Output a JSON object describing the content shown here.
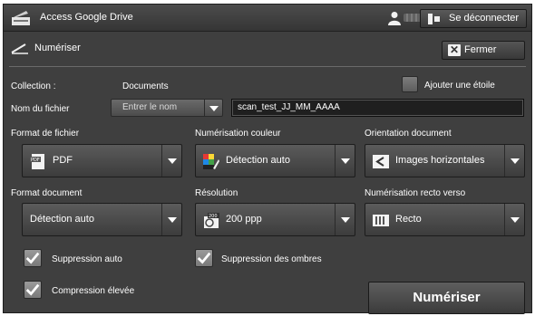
{
  "topbar": {
    "app_title": "Access Google Drive",
    "logout_label": "Se déconnecter"
  },
  "header": {
    "title": "Numériser",
    "close_label": "Fermer"
  },
  "collection": {
    "label": "Collection :",
    "value": "Documents",
    "star_label": "Ajouter une étoile"
  },
  "filename": {
    "label": "Nom du fichier",
    "select_label": "Entrer le nom",
    "value": "scan_test_JJ_MM_AAAA"
  },
  "settings": {
    "file_format": {
      "label": "Format de fichier",
      "value": "PDF"
    },
    "color": {
      "label": "Numérisation couleur",
      "value": "Détection auto"
    },
    "orientation": {
      "label": "Orientation document",
      "value": "Images horizontales"
    },
    "doc_format": {
      "label": "Format document",
      "value": "Détection auto"
    },
    "resolution": {
      "label": "Résolution",
      "value": "200 ppp",
      "icon_text": "200"
    },
    "duplex": {
      "label": "Numérisation recto verso",
      "value": "Recto"
    }
  },
  "options": {
    "auto_suppress": "Suppression auto",
    "shadow_suppress": "Suppression des ombres",
    "high_compression": "Compression élevée"
  },
  "scan_label": "Numériser"
}
